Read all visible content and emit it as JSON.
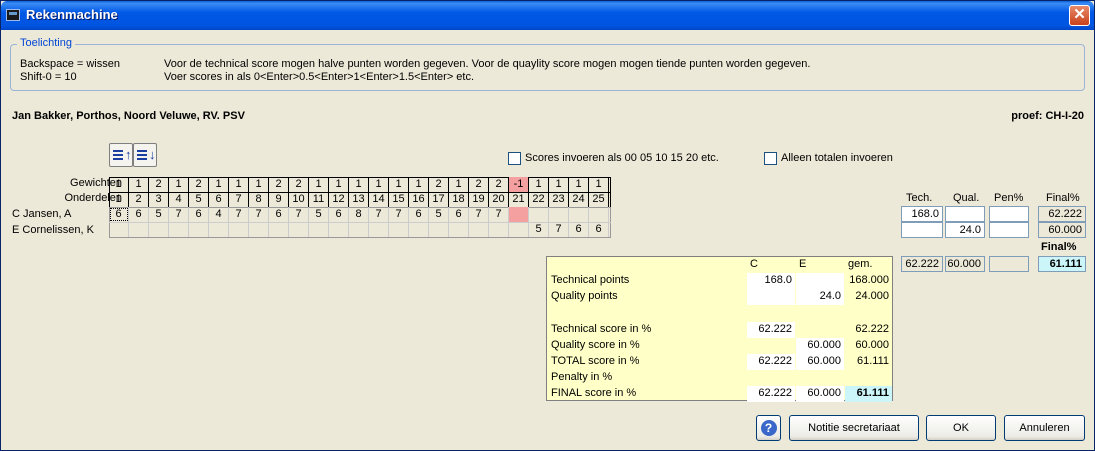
{
  "window": {
    "title": "Rekenmachine",
    "close": "✕"
  },
  "help_box": {
    "title": "Toelichting",
    "key1": "Backspace = wissen",
    "key2": "Shift-0 = 10",
    "line1": "Voor de technical score mogen halve punten worden gegeven. Voor de quaylity score mogen mogen tiende punten worden gegeven.",
    "line2": "Voer scores in als 0<Enter>0.5<Enter>1<Enter>1.5<Enter> etc."
  },
  "header": {
    "rider": "Jan Bakker, Porthos, Noord Veluwe, RV. PSV",
    "proef": "proef: CH-I-20"
  },
  "options": {
    "sort_up_icon": "sort-ascending-icon",
    "sort_down_icon": "sort-descending-icon",
    "checkbox1": "Scores invoeren als 00 05 10 15 20 etc.",
    "checkbox2": "Alleen totalen invoeren"
  },
  "grid": {
    "weights_label": "Gewichten",
    "parts_label": "Onderdelen",
    "weights": [
      "1",
      "1",
      "2",
      "1",
      "2",
      "1",
      "1",
      "1",
      "2",
      "2",
      "1",
      "1",
      "1",
      "1",
      "1",
      "1",
      "2",
      "1",
      "2",
      "2",
      "-1",
      "1",
      "1",
      "1",
      "1"
    ],
    "parts": [
      "1",
      "2",
      "3",
      "4",
      "5",
      "6",
      "7",
      "8",
      "9",
      "10",
      "11",
      "12",
      "13",
      "14",
      "15",
      "16",
      "17",
      "18",
      "19",
      "20",
      "21",
      "22",
      "23",
      "24",
      "25"
    ],
    "judges": [
      {
        "name": "C Jansen, A",
        "scores": [
          "6",
          "6",
          "5",
          "7",
          "6",
          "4",
          "7",
          "7",
          "6",
          "7",
          "5",
          "6",
          "8",
          "7",
          "7",
          "6",
          "5",
          "6",
          "7",
          "7",
          "",
          "",
          "",
          "",
          ""
        ]
      },
      {
        "name": "E Cornelissen, K",
        "scores": [
          "",
          "",
          "",
          "",
          "",
          "",
          "",
          "",
          "",
          "",
          "",
          "",
          "",
          "",
          "",
          "",
          "",
          "",
          "",
          "",
          "",
          "5",
          "7",
          "6",
          "6"
        ]
      }
    ]
  },
  "side": {
    "headers": {
      "tech": "Tech.",
      "qual": "Qual.",
      "pen": "Pen%",
      "final": "Final%"
    },
    "rows": [
      {
        "tech": "168.0",
        "qual": "",
        "pen": "",
        "final": "62.222"
      },
      {
        "tech": "",
        "qual": "24.0",
        "pen": "",
        "final": "60.000"
      }
    ],
    "final_label": "Final%",
    "totals": {
      "tech": "62.222",
      "qual": "60.000",
      "pen": "",
      "final": "61.111"
    }
  },
  "summary": {
    "headers": {
      "c": "C",
      "e": "E",
      "gem": "gem."
    },
    "rows": [
      {
        "label": "Technical points",
        "c": "168.0",
        "e": "",
        "gem": "168.000"
      },
      {
        "label": "Quality points",
        "c": "",
        "e": "24.0",
        "gem": "24.000"
      },
      {
        "label": "",
        "c": "",
        "e": "",
        "gem": ""
      },
      {
        "label": "Technical score in %",
        "c": "62.222",
        "e": "",
        "gem": "62.222"
      },
      {
        "label": "Quality score in %",
        "c": "",
        "e": "60.000",
        "gem": "60.000"
      },
      {
        "label": "TOTAL score in %",
        "c": "62.222",
        "e": "60.000",
        "gem": "61.111"
      },
      {
        "label": "Penalty in %",
        "c": "",
        "e": "",
        "gem": ""
      },
      {
        "label": "FINAL score in %",
        "c": "62.222",
        "e": "60.000",
        "gem": "61.111"
      }
    ]
  },
  "buttons": {
    "help": "?",
    "notitie": "Notitie secretariaat",
    "ok": "OK",
    "annuleren": "Annuleren"
  },
  "colors": {
    "highlight_pink": "#F4A0A0",
    "summary_bg": "#FFFFC8",
    "final_cyan": "#CCF5FA"
  }
}
